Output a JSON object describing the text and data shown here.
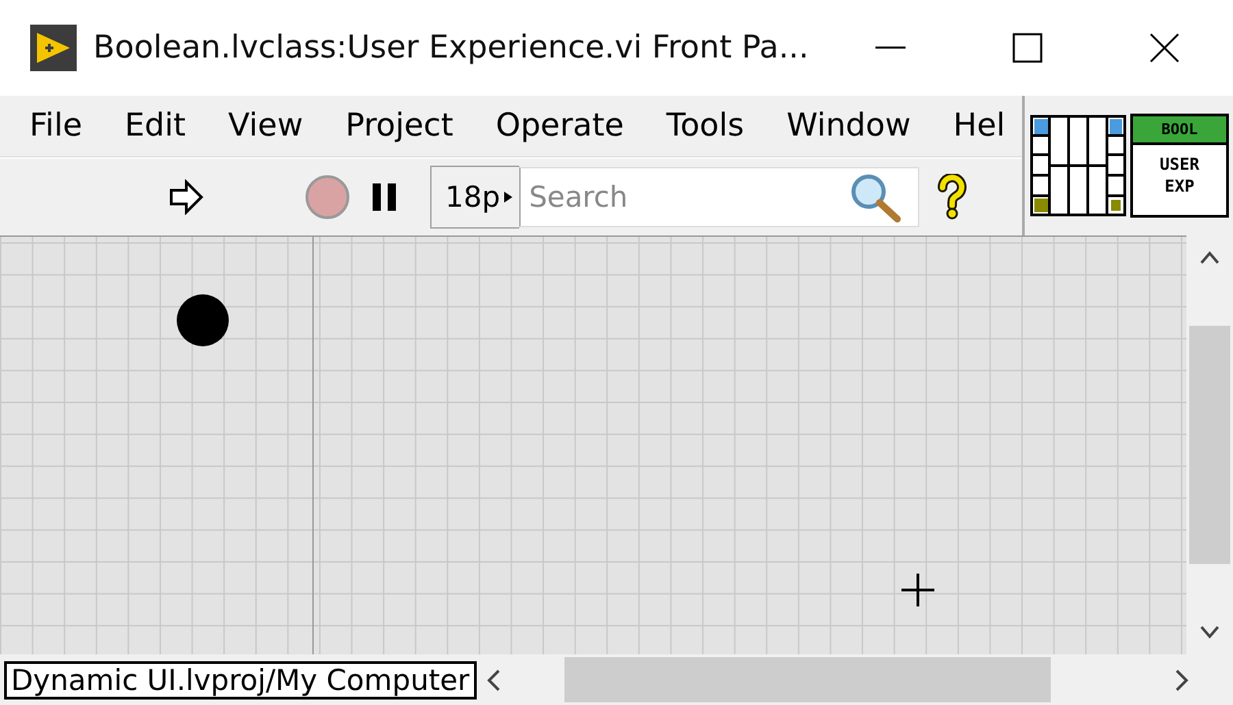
{
  "window": {
    "title": "Boolean.lvclass:User Experience.vi Front Pa..."
  },
  "menu": [
    "File",
    "Edit",
    "View",
    "Project",
    "Operate",
    "Tools",
    "Window",
    "Hel"
  ],
  "toolbar": {
    "font_size": "18p",
    "search": {
      "placeholder": "Search"
    }
  },
  "vi_icon": {
    "banner": "BOOL",
    "lines": [
      "USER",
      "EXP"
    ]
  },
  "status_bar": {
    "context": "Dynamic UI.lvproj/My Computer"
  }
}
